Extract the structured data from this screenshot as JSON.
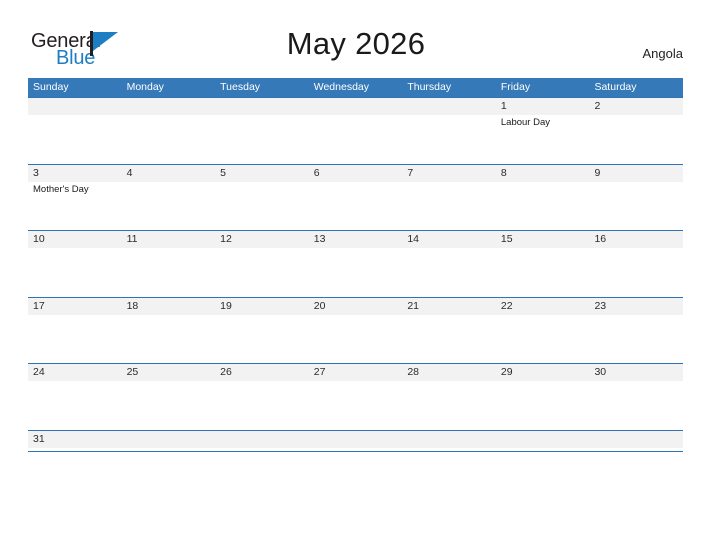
{
  "brand": {
    "word_one": "General",
    "word_two": "Blue",
    "flag_icon": "flag-triangle-icon",
    "accent_color": "#1d7ec4"
  },
  "header": {
    "title": "May 2026",
    "region": "Angola"
  },
  "colors": {
    "header_blue": "#3579b8",
    "row_rule_blue": "#2e74b5",
    "date_band_gray": "#f2f2f2",
    "text_dark": "#1a1a1a",
    "header_text": "#ffffff"
  },
  "calendar": {
    "month": "May",
    "year": "2026",
    "weekday_headers": [
      "Sunday",
      "Monday",
      "Tuesday",
      "Wednesday",
      "Thursday",
      "Friday",
      "Saturday"
    ],
    "weeks": [
      [
        {
          "date": "",
          "events": []
        },
        {
          "date": "",
          "events": []
        },
        {
          "date": "",
          "events": []
        },
        {
          "date": "",
          "events": []
        },
        {
          "date": "",
          "events": []
        },
        {
          "date": "1",
          "events": [
            "Labour Day"
          ]
        },
        {
          "date": "2",
          "events": []
        }
      ],
      [
        {
          "date": "3",
          "events": [
            "Mother's Day"
          ]
        },
        {
          "date": "4",
          "events": []
        },
        {
          "date": "5",
          "events": []
        },
        {
          "date": "6",
          "events": []
        },
        {
          "date": "7",
          "events": []
        },
        {
          "date": "8",
          "events": []
        },
        {
          "date": "9",
          "events": []
        }
      ],
      [
        {
          "date": "10",
          "events": []
        },
        {
          "date": "11",
          "events": []
        },
        {
          "date": "12",
          "events": []
        },
        {
          "date": "13",
          "events": []
        },
        {
          "date": "14",
          "events": []
        },
        {
          "date": "15",
          "events": []
        },
        {
          "date": "16",
          "events": []
        }
      ],
      [
        {
          "date": "17",
          "events": []
        },
        {
          "date": "18",
          "events": []
        },
        {
          "date": "19",
          "events": []
        },
        {
          "date": "20",
          "events": []
        },
        {
          "date": "21",
          "events": []
        },
        {
          "date": "22",
          "events": []
        },
        {
          "date": "23",
          "events": []
        }
      ],
      [
        {
          "date": "24",
          "events": []
        },
        {
          "date": "25",
          "events": []
        },
        {
          "date": "26",
          "events": []
        },
        {
          "date": "27",
          "events": []
        },
        {
          "date": "28",
          "events": []
        },
        {
          "date": "29",
          "events": []
        },
        {
          "date": "30",
          "events": []
        }
      ],
      [
        {
          "date": "31",
          "events": []
        },
        {
          "date": "",
          "events": []
        },
        {
          "date": "",
          "events": []
        },
        {
          "date": "",
          "events": []
        },
        {
          "date": "",
          "events": []
        },
        {
          "date": "",
          "events": []
        },
        {
          "date": "",
          "events": []
        }
      ]
    ]
  }
}
